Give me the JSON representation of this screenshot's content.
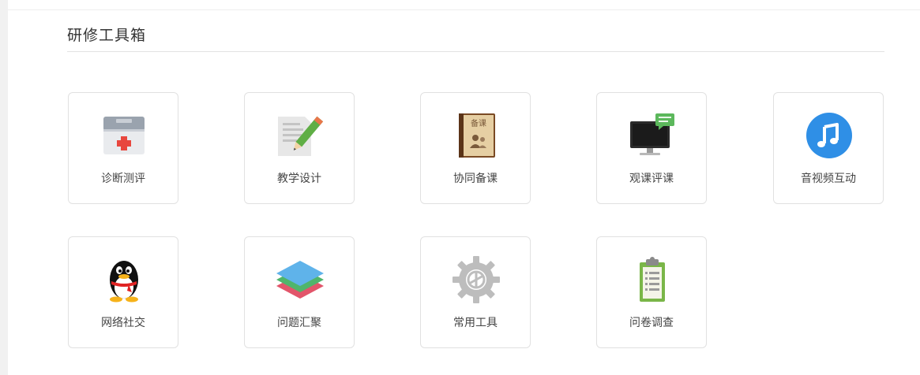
{
  "section": {
    "title": "研修工具箱"
  },
  "tools": [
    {
      "label": "诊断测评",
      "icon": "first-aid-kit-icon"
    },
    {
      "label": "教学设计",
      "icon": "pencil-document-icon"
    },
    {
      "label": "协同备课",
      "icon": "lesson-book-icon"
    },
    {
      "label": "观课评课",
      "icon": "monitor-comment-icon"
    },
    {
      "label": "音视频互动",
      "icon": "music-note-icon"
    },
    {
      "label": "网络社交",
      "icon": "qq-penguin-icon"
    },
    {
      "label": "问题汇聚",
      "icon": "layers-icon"
    },
    {
      "label": "常用工具",
      "icon": "gear-icon"
    },
    {
      "label": "问卷调查",
      "icon": "clipboard-icon"
    }
  ],
  "icon_texts": {
    "book_cover": "备课"
  }
}
